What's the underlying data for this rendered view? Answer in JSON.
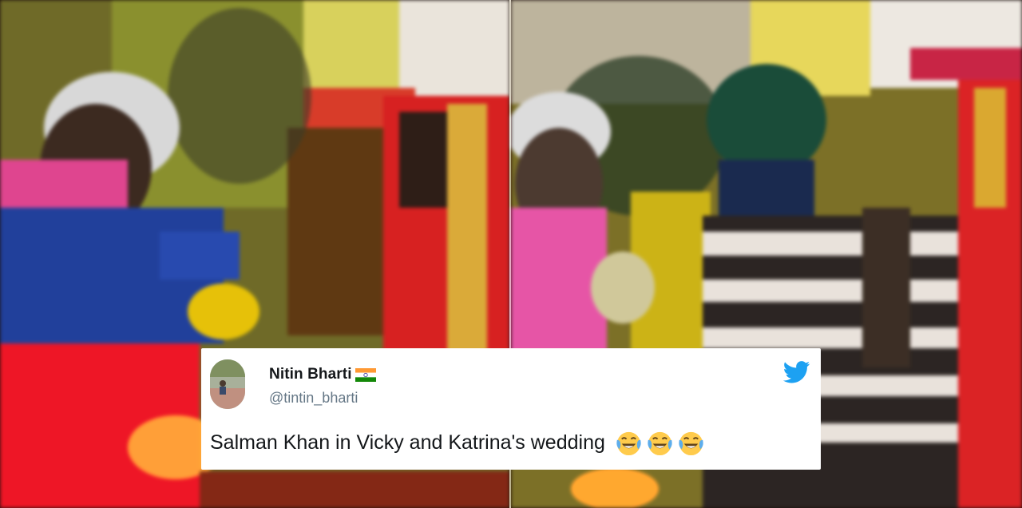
{
  "tweet": {
    "display_name": "Nitin Bharti",
    "handle": "@tintin_bharti",
    "text": "Salman Khan in Vicky and Katrina's wedding",
    "emoji_count": 3,
    "emoji": "face-with-tears-of-joy-icon",
    "accent_color": "#1da1f2"
  },
  "colors": {
    "tweet_background": "#ffffff",
    "name_color": "#14171a",
    "handle_color": "#657786"
  }
}
